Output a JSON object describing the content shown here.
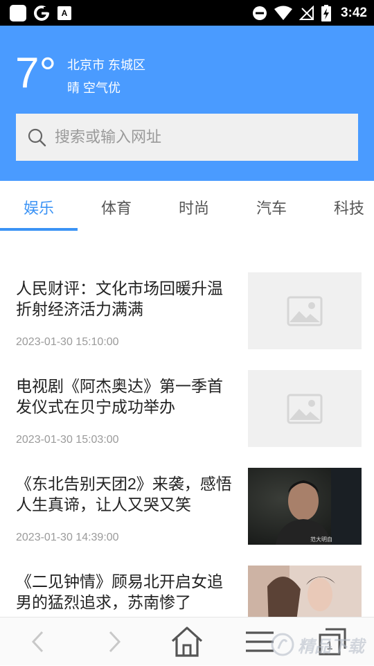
{
  "status_bar": {
    "time": "3:42",
    "left_icons": [
      "square-app-icon",
      "google-g-icon",
      "keyboard-a-icon"
    ],
    "right_icons": [
      "do-not-disturb-icon",
      "wifi-icon",
      "no-signal-icon",
      "battery-charging-icon"
    ],
    "google_letter": "G",
    "keyboard_letter": "A"
  },
  "header": {
    "temperature": "7°",
    "location": "北京市 东城区",
    "weather": "晴 空气优",
    "bg_color": "#4a9bff"
  },
  "search": {
    "placeholder": "搜索或输入网址"
  },
  "tabs": [
    {
      "label": "娱乐",
      "active": true
    },
    {
      "label": "体育",
      "active": false
    },
    {
      "label": "时尚",
      "active": false
    },
    {
      "label": "汽车",
      "active": false
    },
    {
      "label": "科技",
      "active": false
    }
  ],
  "news": [
    {
      "title": "人民财评：文化市场回暖升温折射经济活力满满",
      "time": "2023-01-30 15:10:00",
      "thumb": "placeholder-image"
    },
    {
      "title": "电视剧《阿杰奥达》第一季首发仪式在贝宁成功举办",
      "time": "2023-01-30 15:03:00",
      "thumb": "placeholder-image"
    },
    {
      "title": "《东北告别天团2》来袭，感悟人生真谛，让人又哭又笑",
      "time": "2023-01-30 14:39:00",
      "thumb": "photo-man-dark",
      "caption": "范大明自"
    },
    {
      "title": "《二见钟情》顾易北开启女追男的猛烈追求，苏南惨了",
      "time": "",
      "thumb": "photo-couple"
    }
  ],
  "bottom_nav": {
    "tab_count": "1",
    "icons": [
      "back-arrow-icon",
      "forward-arrow-icon",
      "home-icon",
      "menu-icon",
      "tabs-icon"
    ]
  },
  "watermark": {
    "text": "精品下载"
  }
}
